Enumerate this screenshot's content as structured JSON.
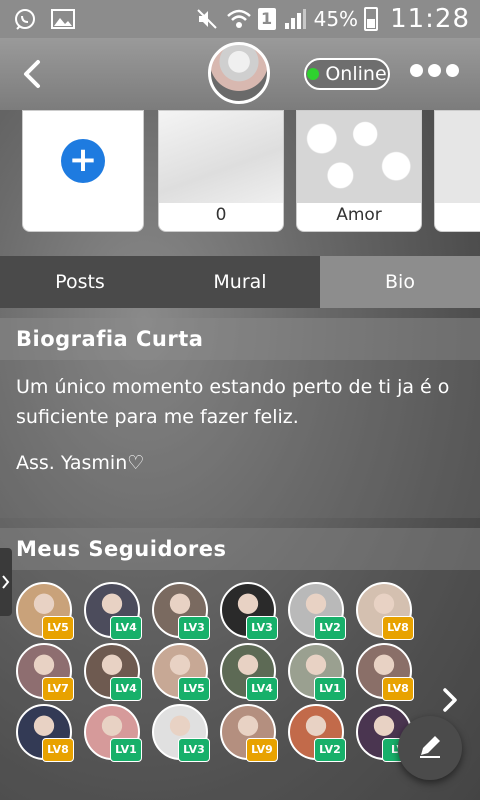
{
  "status": {
    "battery": "45%",
    "time": "11:28",
    "sim": "1"
  },
  "header": {
    "status_label": "Online"
  },
  "cards": [
    {
      "label": ""
    },
    {
      "label": "0"
    },
    {
      "label": "Amor"
    },
    {
      "label": ""
    }
  ],
  "tabs": [
    {
      "label": "Posts"
    },
    {
      "label": "Mural"
    },
    {
      "label": "Bio"
    }
  ],
  "bio": {
    "title": "Biografia Curta",
    "text": "Um único momento estando perto de ti ja é o suficiente para me fazer feliz.",
    "signature": "Ass. Yasmin♡"
  },
  "followers": {
    "title": "Meus Seguidores",
    "rows": [
      [
        {
          "level": "LV5",
          "color": "#e8a200"
        },
        {
          "level": "LV4",
          "color": "#17b06a"
        },
        {
          "level": "LV3",
          "color": "#17b06a"
        },
        {
          "level": "LV3",
          "color": "#17b06a"
        },
        {
          "level": "LV2",
          "color": "#17b06a"
        },
        {
          "level": "LV8",
          "color": "#e8a200"
        }
      ],
      [
        {
          "level": "LV7",
          "color": "#e8a200"
        },
        {
          "level": "LV4",
          "color": "#17b06a"
        },
        {
          "level": "LV5",
          "color": "#17b06a"
        },
        {
          "level": "LV4",
          "color": "#17b06a"
        },
        {
          "level": "LV1",
          "color": "#17b06a"
        },
        {
          "level": "LV8",
          "color": "#e8a200"
        }
      ],
      [
        {
          "level": "LV8",
          "color": "#e8a200"
        },
        {
          "level": "LV1",
          "color": "#17b06a"
        },
        {
          "level": "LV3",
          "color": "#17b06a"
        },
        {
          "level": "LV9",
          "color": "#e8a200"
        },
        {
          "level": "LV2",
          "color": "#17b06a"
        },
        {
          "level": "LV",
          "color": "#17b06a"
        }
      ]
    ]
  },
  "icons": {
    "status_left": [
      "whatsapp-icon",
      "gallery-icon"
    ],
    "status_right": [
      "mute-icon",
      "wifi-icon",
      "signal-icon",
      "battery-icon"
    ],
    "back": "back-arrow-icon",
    "more": "more-dots-icon",
    "add": "plus-icon",
    "next": "chevron-right-icon",
    "fab": "pencil-icon"
  },
  "colors": {
    "accent": "#1e7be0",
    "online": "#2fd12f",
    "level_green": "#17b06a",
    "level_gold": "#e8a200"
  }
}
